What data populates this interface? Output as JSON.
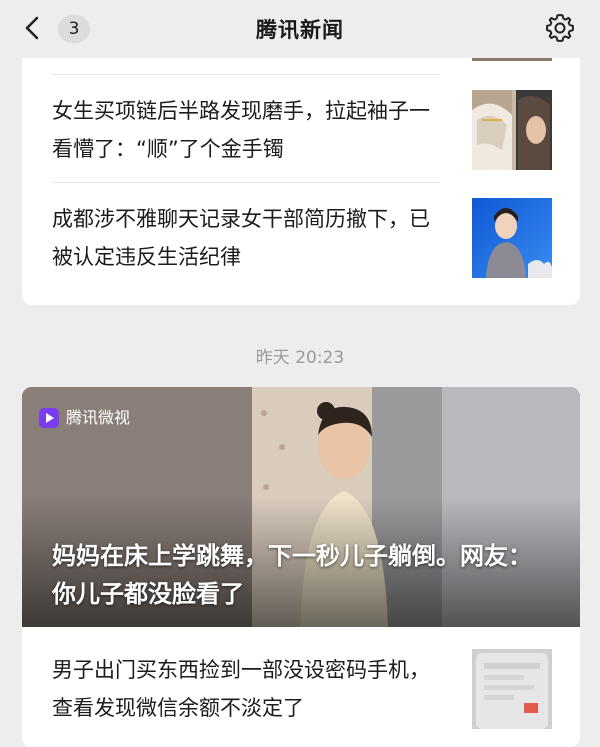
{
  "header": {
    "back_count": "3",
    "title": "腾讯新闻"
  },
  "card1": {
    "items": [
      {
        "title": "女生买项链后半路发现磨手，拉起袖子一看懵了：“顺”了个金手镯"
      },
      {
        "title": "成都涉不雅聊天记录女干部简历撤下，已被认定违反生活纪律"
      }
    ]
  },
  "time_label": "昨天 20:23",
  "card2": {
    "source": "腾讯微视",
    "hero_title": "妈妈在床上学跳舞，下一秒儿子躺倒。网友：你儿子都没脸看了",
    "items": [
      {
        "title": "男子出门买东西捡到一部没设密码手机，查看发现微信余额不淡定了"
      }
    ]
  }
}
